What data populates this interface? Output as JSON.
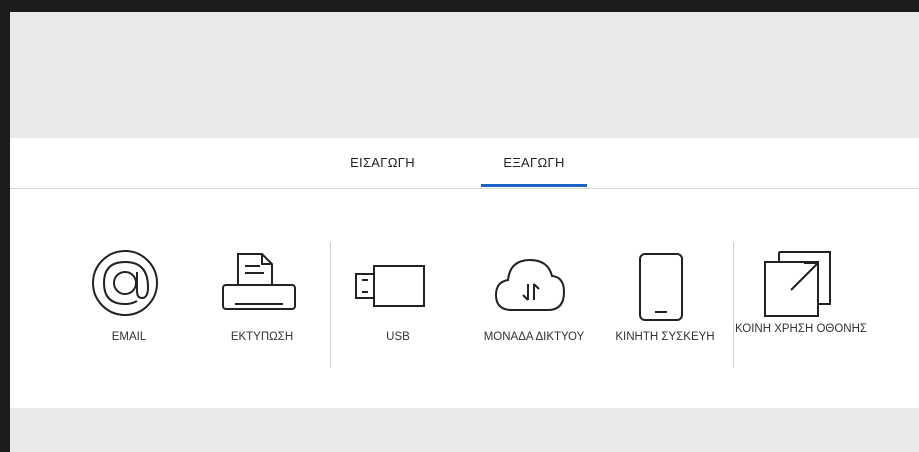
{
  "tabs": [
    {
      "label": "ΕΙΣΑΓΩΓΗ",
      "active": false
    },
    {
      "label": "ΕΞΑΓΩΓΗ",
      "active": true
    }
  ],
  "accent_color": "#1a64c8",
  "items": [
    {
      "label": "EMAIL",
      "icon": "at-sign-icon"
    },
    {
      "label": "ΕΚΤΥΠΩΣΗ",
      "icon": "printer-icon"
    },
    {
      "label": "USB",
      "icon": "usb-drive-icon"
    },
    {
      "label": "ΜΟΝΑΔΑ ΔΙΚΤΥΟΥ",
      "icon": "cloud-transfer-icon"
    },
    {
      "label": "ΚΙΝΗΤΗ ΣΥΣΚΕΥΗ",
      "icon": "mobile-device-icon"
    },
    {
      "label": "ΚΟΙΝΗ ΧΡΗΣΗ ΟΘΟΝΗΣ",
      "icon": "screen-share-icon"
    }
  ]
}
